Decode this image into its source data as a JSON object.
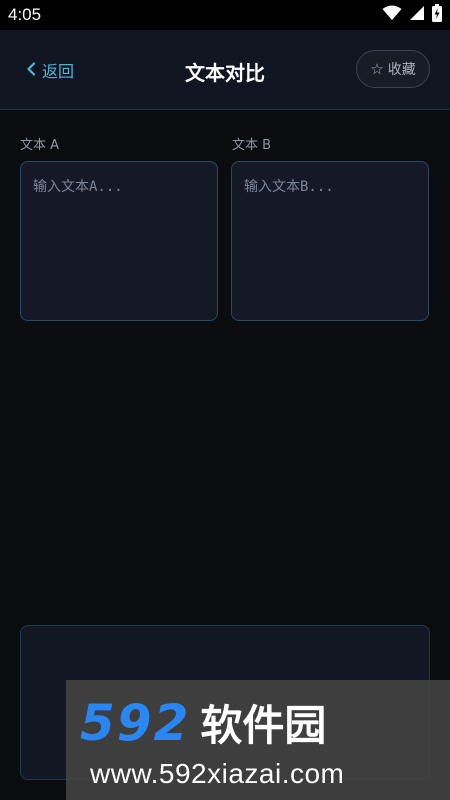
{
  "status_bar": {
    "time": "4:05",
    "icons": [
      "wifi-icon",
      "signal-icon",
      "battery-icon"
    ]
  },
  "app_bar": {
    "back_label": "返回",
    "title": "文本对比",
    "favorite_label": "收藏"
  },
  "editor": {
    "text_a": {
      "label": "文本 A",
      "value": "",
      "placeholder": "输入文本A..."
    },
    "text_b": {
      "label": "文本 B",
      "value": "",
      "placeholder": "输入文本B..."
    }
  },
  "result": {
    "content": ""
  },
  "watermark": {
    "brand_number": "592",
    "brand_name": "软件园",
    "url": "www.592xiazai.com"
  },
  "colors": {
    "accent": "#4fb7d6",
    "background": "#0b0c10",
    "header": "#101521",
    "watermark_blue": "#2a86f2"
  }
}
